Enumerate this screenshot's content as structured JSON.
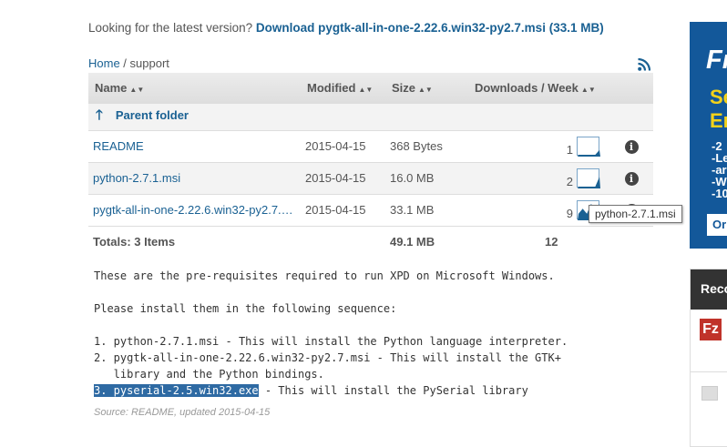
{
  "latest": {
    "prefix": "Looking for the latest version?",
    "link": "Download pygtk-all-in-one-2.22.6.win32-py2.7.msi (33.1 MB)"
  },
  "breadcrumb": {
    "home": "Home",
    "sep": " / ",
    "current": "support"
  },
  "table": {
    "headers": {
      "name": "Name",
      "modified": "Modified",
      "size": "Size",
      "downloads": "Downloads / Week"
    },
    "parent_label": "Parent folder",
    "rows": [
      {
        "name": "README",
        "modified": "2015-04-15",
        "size": "368 Bytes",
        "downloads": "1",
        "weekly": [
          0,
          0,
          0,
          0,
          0,
          1
        ]
      },
      {
        "name": "python-2.7.1.msi",
        "modified": "2015-04-15",
        "size": "16.0 MB",
        "downloads": "2",
        "weekly": [
          0,
          0,
          0,
          0,
          0,
          2
        ]
      },
      {
        "name": "pygtk-all-in-one-2.22.6.win32-py2.7.…",
        "modified": "2015-04-15",
        "size": "33.1 MB",
        "downloads": "9",
        "weekly": [
          1,
          2,
          1,
          3,
          2,
          3
        ]
      }
    ],
    "totals": {
      "label": "Totals: 3 Items",
      "size": "49.1 MB",
      "downloads": "12"
    }
  },
  "tooltip": "python-2.7.1.msi",
  "readme": {
    "line1": "These are the pre-requisites required to run XPD on Microsoft Windows.",
    "line2": "Please install them in the following sequence:",
    "item1": "1. python-2.7.1.msi - This will install the Python language interpreter.",
    "item2a": "2. pygtk-all-in-one-2.22.6.win32-py2.7.msi - This will install the GTK+",
    "item2b": "   library and the Python bindings.",
    "item3_selected": "3. pyserial-2.5.win32.exe",
    "item3_rest": " - This will install the PySerial library"
  },
  "source_note": "Source: README, updated 2015-04-15",
  "ad": {
    "t1": "Fr",
    "t2a": "Se",
    "t2b": "Er",
    "lines": "-2\n-Le\n-ar\n-W\n-10",
    "button": "Or"
  },
  "recommended": {
    "title": "Reco",
    "fz": "Fz"
  },
  "colors": {
    "link": "#1a6193",
    "selection": "#2e6aa3",
    "ad_bg": "#13589a",
    "ad_accent": "#f3d21a"
  }
}
